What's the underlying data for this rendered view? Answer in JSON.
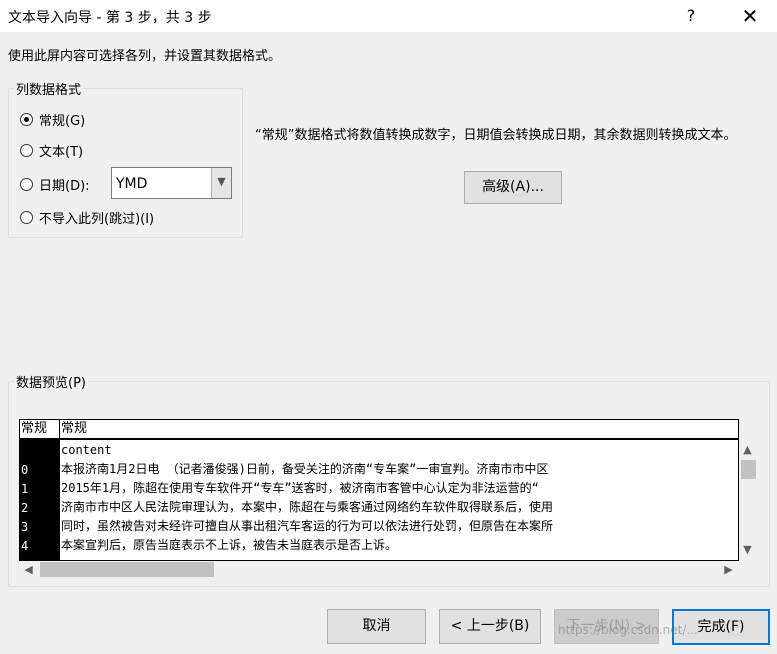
{
  "window": {
    "title": "文本导入向导 - 第 3 步，共 3 步",
    "help_label": "?",
    "close_label": "✕"
  },
  "instruction": "使用此屏内容可选择各列，并设置其数据格式。",
  "column_format": {
    "legend": "列数据格式",
    "options": [
      {
        "label": "常规(G)",
        "checked": true
      },
      {
        "label": "文本(T)",
        "checked": false
      },
      {
        "label": "日期(D):",
        "checked": false
      },
      {
        "label": "不导入此列(跳过)(I)",
        "checked": false
      }
    ],
    "date_format_value": "YMD"
  },
  "description": "“常规”数据格式将数值转换成数字，日期值会转换成日期，其余数据则转换成文本。",
  "advanced_button": "高级(A)...",
  "preview": {
    "legend": "数据预览(P)",
    "header": [
      "常规",
      "常规"
    ],
    "rows": [
      {
        "index": "",
        "text": "content"
      },
      {
        "index": "0",
        "text": "    本报济南1月2日电 （记者潘俊强)日前，备受关注的济南“专车案”一审宣判。济南市市中区"
      },
      {
        "index": "1",
        "text": "    2015年1月，陈超在使用专车软件开“专车”送客时，被济南市客管中心认定为非法运营的“"
      },
      {
        "index": "2",
        "text": "    济南市市中区人民法院审理认为，本案中，陈超在与乘客通过网络约车软件取得联系后，使用"
      },
      {
        "index": "3",
        "text": "    同时，虽然被告对未经许可擅自从事出租汽车客运的行为可以依法进行处罚，但原告在本案所"
      },
      {
        "index": "4",
        "text": "    本案宣判后，原告当庭表示不上诉，被告未当庭表示是否上诉。"
      }
    ]
  },
  "scroll_icons": {
    "up": "▲",
    "down": "▼",
    "left": "◀",
    "right": "▶"
  },
  "buttons": {
    "cancel": "取消",
    "back": "< 上一步(B)",
    "next": "下一步(N) >",
    "finish": "完成(F)"
  },
  "watermark": "https://blog.csdn.net/..."
}
